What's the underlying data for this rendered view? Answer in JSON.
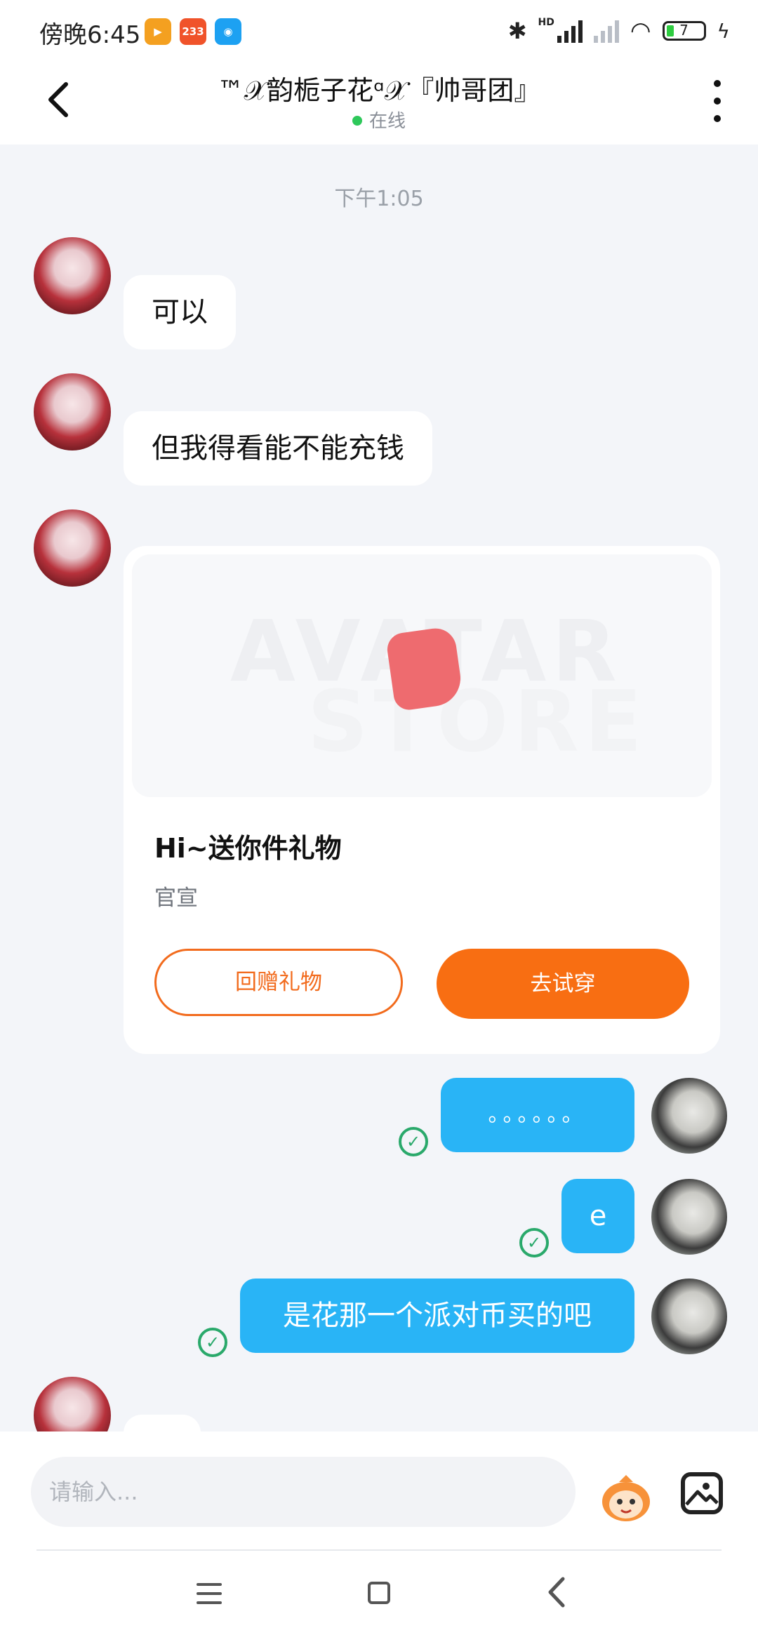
{
  "status_bar": {
    "time": "傍晚6:45",
    "app_icons": [
      {
        "name": "video-app-icon",
        "color": "#f4a020",
        "label": ""
      },
      {
        "name": "233-app-icon",
        "color": "#f0532a",
        "label": "233"
      },
      {
        "name": "blue-app-icon",
        "color": "#1da1f2",
        "label": ""
      }
    ],
    "hd_label": "HD",
    "battery_level": "7"
  },
  "header": {
    "title": "™𝒳韵栀子花ᵅ𝒳『帅哥团』",
    "status": "在线"
  },
  "chat": {
    "timestamp": "下午1:05",
    "incoming": [
      {
        "text": "可以"
      },
      {
        "text": "但我得看能不能充钱"
      }
    ],
    "gift_card": {
      "watermark_line1": "AVATAR",
      "watermark_line2": "STORE",
      "title": "Hi~送你件礼物",
      "subtitle": "官宣",
      "return_button": "回赠礼物",
      "try_button": "去试穿"
    },
    "outgoing": [
      {
        "text": "。。。。。。"
      },
      {
        "text": "e"
      },
      {
        "text": "是花那一个派对币买的吧"
      }
    ]
  },
  "input_bar": {
    "placeholder": "请输入..."
  },
  "colors": {
    "accent_orange": "#f86e12",
    "bubble_blue": "#29b4f6",
    "online_green": "#2ec85a",
    "read_check_green": "#2aa96b"
  }
}
